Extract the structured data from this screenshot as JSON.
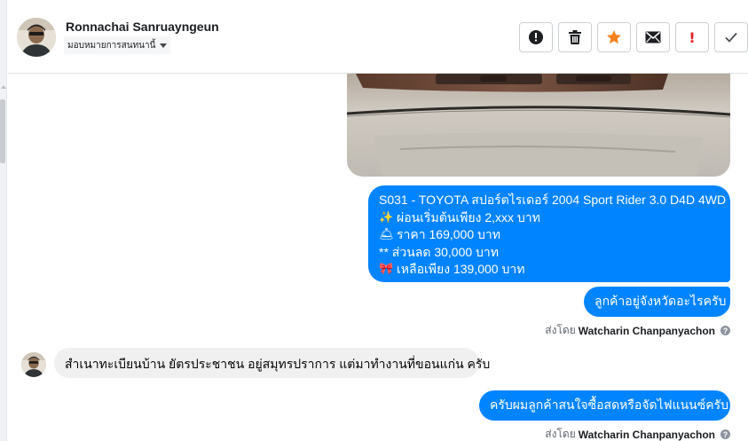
{
  "header": {
    "contact_name": "Ronnachai Sanruayngeun",
    "assign_label": "มอบหมายการสนทนานี้",
    "avatar_icon": "user-avatar-photo",
    "actions": [
      {
        "name": "spam-button",
        "icon": "alert-circle-icon"
      },
      {
        "name": "delete-button",
        "icon": "trash-icon"
      },
      {
        "name": "star-button",
        "icon": "star-icon",
        "color": "#f5821f"
      },
      {
        "name": "mark-unread-button",
        "icon": "envelope-icon"
      },
      {
        "name": "follow-up-button",
        "icon": "exclamation-icon",
        "color": "#e02020"
      },
      {
        "name": "done-button",
        "icon": "checkmark-icon"
      }
    ]
  },
  "thread": {
    "listing": {
      "lines": [
        {
          "emoji": "",
          "text": "S031 - TOYOTA สปอร์ตไรเดอร์ 2004 Sport Rider 3.0 D4D 4WD"
        },
        {
          "emoji": "✨",
          "text": "ผ่อนเริ่มต้นเพียง 2,xxx บาท"
        },
        {
          "emoji": "🛎",
          "text": "ราคา 169,000 บาท"
        },
        {
          "emoji": "",
          "text": "** ส่วนลด 30,000 บาท"
        },
        {
          "emoji": "🎀",
          "text": "เหลือเพียง 139,000 บาท"
        }
      ]
    },
    "question": "ลูกค้าอยู่จังหวัดอะไรครับ",
    "sent_by_prefix": "ส่งโดย",
    "sent_by_name": "Watcharin Chanpanyachon",
    "incoming": "สำเนาทะเบียนบ้าน ยัตรประชาชน อยู่สมุทรปราการ แต่มาทำงานที่ขอนแก่น ครับ",
    "reply": "ครับผมลูกค้าสนใจซื้อสดหรือจัดไฟแนนซ์ครับ"
  },
  "colors": {
    "outgoing_bubble": "#0084ff",
    "incoming_bubble": "#f1f0f0",
    "star": "#f5821f",
    "follow_up": "#e02020"
  }
}
